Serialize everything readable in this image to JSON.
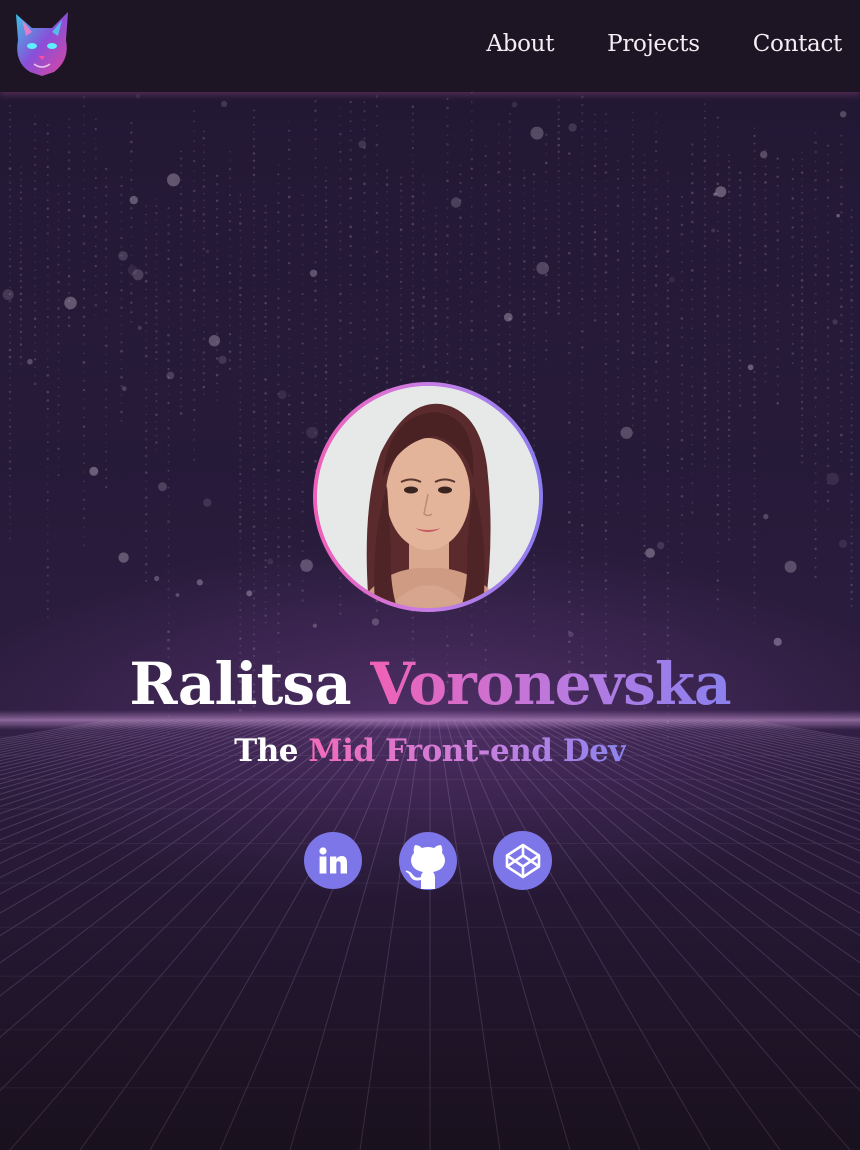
{
  "header": {
    "logo_alt": "cat logo",
    "nav": [
      {
        "label": "About"
      },
      {
        "label": "Projects"
      },
      {
        "label": "Contact"
      }
    ]
  },
  "hero": {
    "first_name": "Ralitsa",
    "last_name": "Voronevska",
    "role_prefix": "The",
    "role_title": "Mid Front-end Dev",
    "avatar_alt": "portrait photo"
  },
  "socials": [
    {
      "name": "LinkedIn",
      "icon": "linkedin-icon"
    },
    {
      "name": "GitHub",
      "icon": "github-icon"
    },
    {
      "name": "CodePen",
      "icon": "codepen-icon"
    }
  ],
  "colors": {
    "background": "#261a39",
    "header": "#1d1524",
    "accent_pink": "#f061b6",
    "accent_violet": "#8a80ee",
    "social_button": "#7d76e8"
  }
}
